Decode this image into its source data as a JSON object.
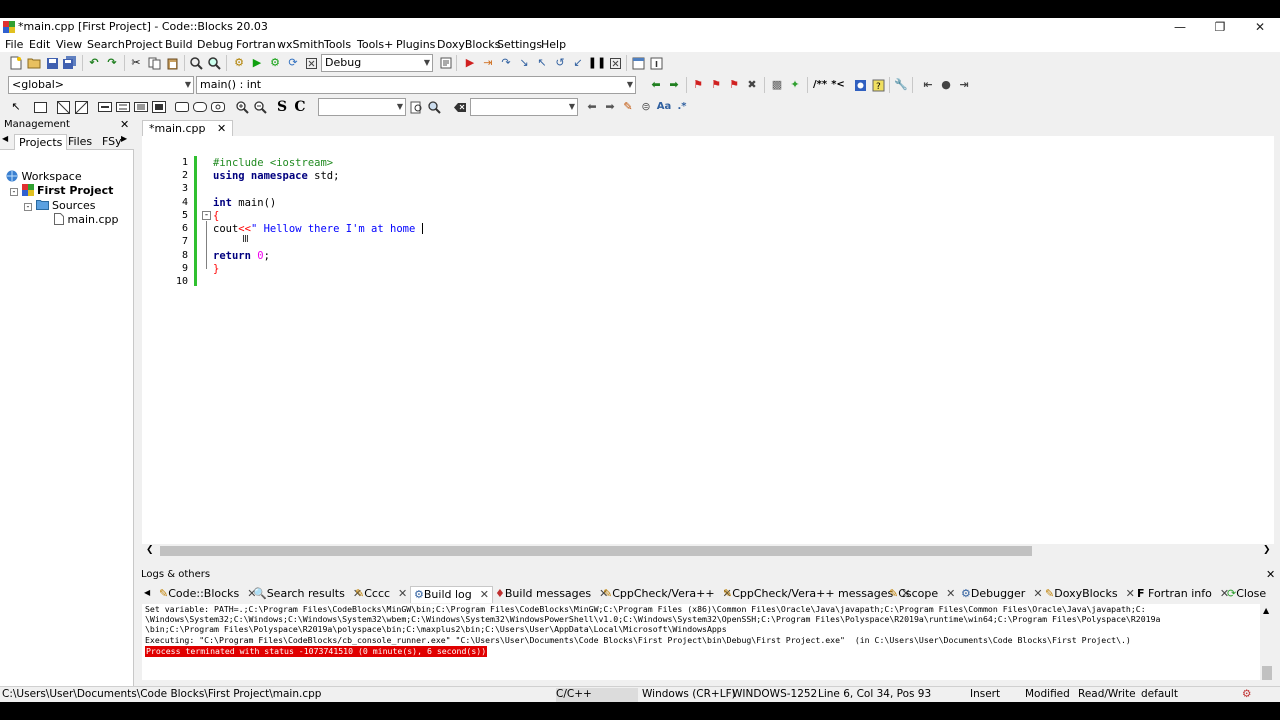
{
  "window": {
    "title": "*main.cpp [First Project] - Code::Blocks 20.03"
  },
  "menu": [
    "File",
    "Edit",
    "View",
    "Search",
    "Project",
    "Build",
    "Debug",
    "Fortran",
    "wxSmith",
    "Tools",
    "Tools+",
    "Plugins",
    "DoxyBlocks",
    "Settings",
    "Help"
  ],
  "toolbar": {
    "build_target": "Debug",
    "scope": "<global>",
    "function": "main() : int",
    "wx_s": "S",
    "wx_c": "C",
    "find_text": "",
    "search_text": ""
  },
  "management": {
    "title": "Management",
    "tabs": [
      "Projects",
      "Files",
      "FSy"
    ],
    "workspace": "Workspace",
    "project": "First Project",
    "folder": "Sources",
    "file": "main.cpp"
  },
  "editor": {
    "tab_label": "*main.cpp",
    "line_numbers": [
      "1",
      "2",
      "3",
      "4",
      "5",
      "6",
      "7",
      "8",
      "9",
      "10"
    ],
    "lines": {
      "l1": "#include <iostream>",
      "l2_kw": "using namespace",
      "l2_rest": " std;",
      "l4_kw": "int",
      "l4_rest": " main()",
      "l5": "{",
      "l6_id": "cout",
      "l6_op": "<<",
      "l6_str": "\" Hellow there I'm at home ",
      "l8_kw": "return",
      "l8_num": "0",
      "l8_semi": ";",
      "l9": "}"
    }
  },
  "logs": {
    "title": "Logs & others",
    "tabs": [
      "Code::Blocks",
      "Search results",
      "Cccc",
      "Build log",
      "Build messages",
      "CppCheck/Vera++",
      "CppCheck/Vera++ messages",
      "Cscope",
      "Debugger",
      "DoxyBlocks",
      "Fortran info",
      "Close"
    ],
    "lines": [
      "Set variable: PATH=.;C:\\Program Files\\CodeBlocks\\MinGW\\bin;C:\\Program Files\\CodeBlocks\\MinGW;C:\\Program Files (x86)\\Common Files\\Oracle\\Java\\javapath;C:\\Program Files\\Common Files\\Oracle\\Java\\javapath;C:",
      "\\Windows\\System32;C:\\Windows;C:\\Windows\\System32\\wbem;C:\\Windows\\System32\\WindowsPowerShell\\v1.0;C:\\Windows\\System32\\OpenSSH;C:\\Program Files\\Polyspace\\R2019a\\runtime\\win64;C:\\Program Files\\Polyspace\\R2019a",
      "\\bin;C:\\Program Files\\Polyspace\\R2019a\\polyspace\\bin;C:\\maxplus2\\bin;C:\\Users\\User\\AppData\\Local\\Microsoft\\WindowsApps",
      "Executing: \"C:\\Program Files\\CodeBlocks/cb_console_runner.exe\" \"C:\\Users\\User\\Documents\\Code Blocks\\First Project\\bin\\Debug\\First Project.exe\"  (in C:\\Users\\User\\Documents\\Code Blocks\\First Project\\.)"
    ],
    "error_line": "Process terminated with status -1073741510 (0 minute(s), 6 second(s))"
  },
  "status": {
    "path": "C:\\Users\\User\\Documents\\Code Blocks\\First Project\\main.cpp",
    "language": "C/C++",
    "eol": "Windows (CR+LF)",
    "encoding": "WINDOWS-1252",
    "position": "Line 6, Col 34, Pos 93",
    "mode": "Insert",
    "modified": "Modified",
    "access": "Read/Write",
    "profile": "default"
  },
  "colors": {
    "keyword": "#00007f",
    "preprocessor": "#228b22",
    "string": "#0000ff",
    "number": "#f000f0",
    "operator": "#ff0000",
    "error_bg": "#e00000"
  }
}
